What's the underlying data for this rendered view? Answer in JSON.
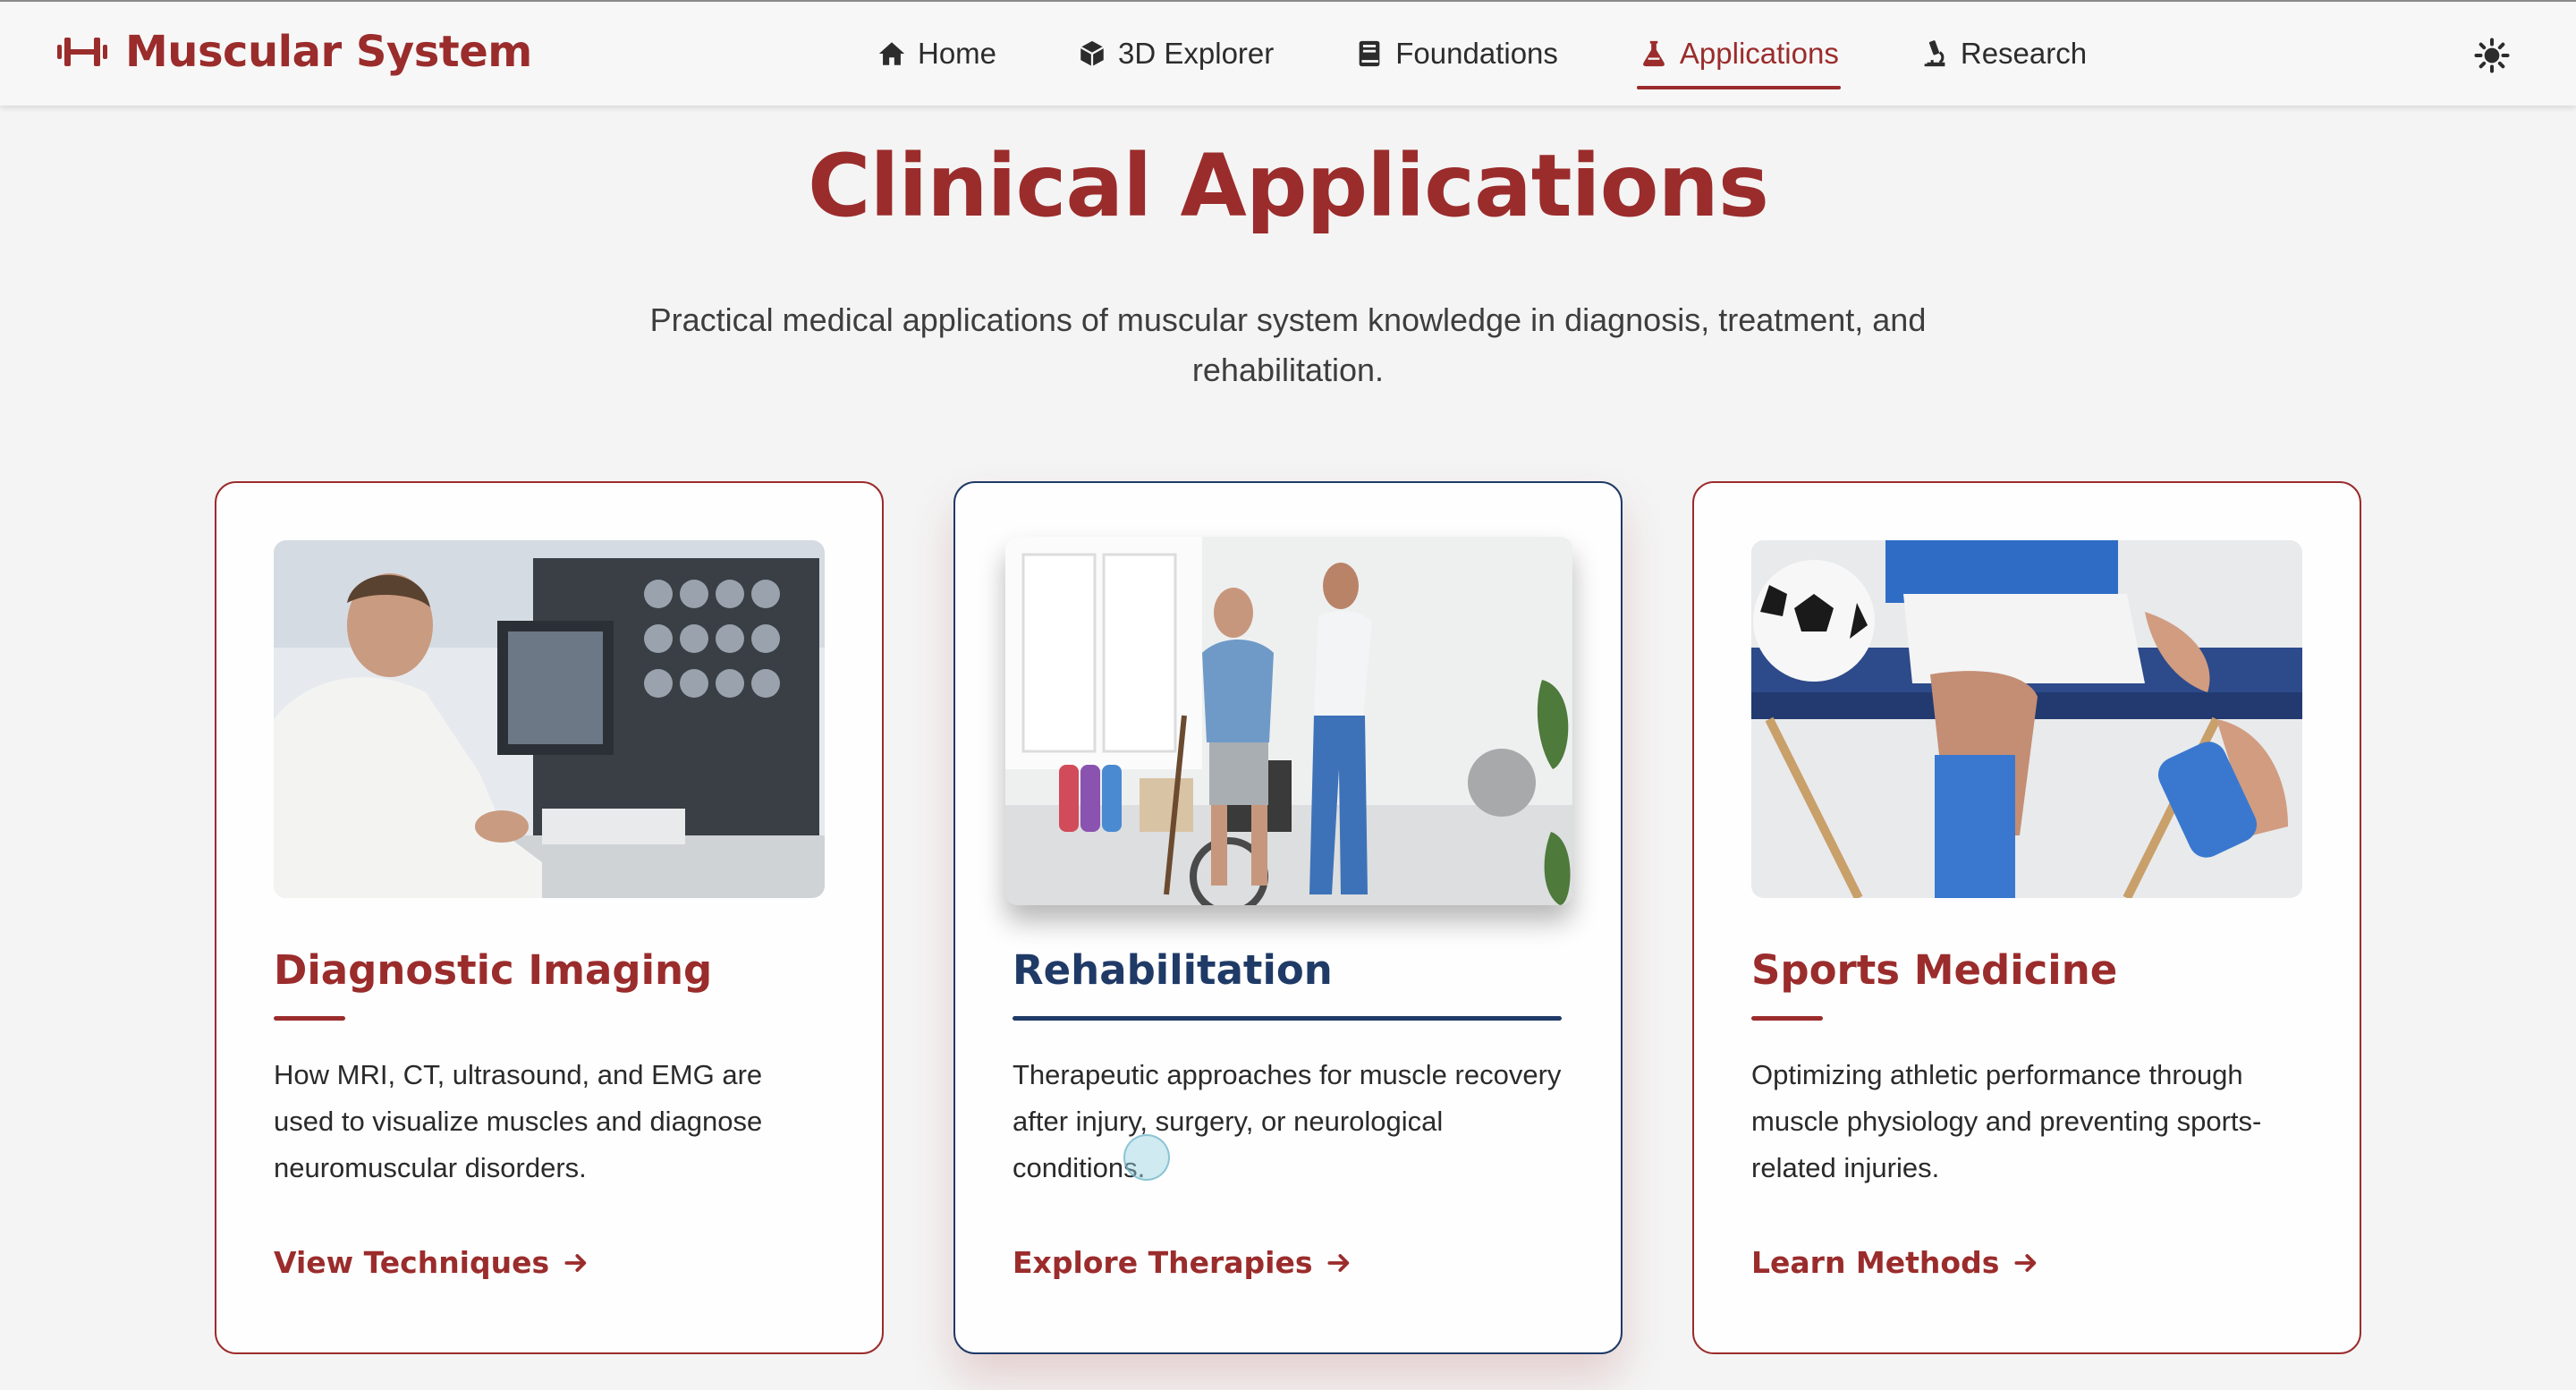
{
  "brand": {
    "name": "Muscular System",
    "icon": "dumbbell-icon"
  },
  "nav": {
    "items": [
      {
        "label": "Home",
        "icon": "home-icon"
      },
      {
        "label": "3D Explorer",
        "icon": "cube-icon"
      },
      {
        "label": "Foundations",
        "icon": "book-icon"
      },
      {
        "label": "Applications",
        "icon": "flask-icon",
        "active": true
      },
      {
        "label": "Research",
        "icon": "microscope-icon"
      }
    ],
    "theme_toggle_icon": "sun-icon"
  },
  "hero": {
    "title": "Clinical Applications",
    "subtitle": "Practical medical applications of muscular system knowledge in diagnosis, treatment, and rehabilitation."
  },
  "cards": [
    {
      "title": "Diagnostic Imaging",
      "description": "How MRI, CT, ultrasound, and EMG are used to visualize muscles and diagnose neuromuscular disorders.",
      "link": "View Techniques",
      "image": "doctor-reviewing-scans-photo"
    },
    {
      "title": "Rehabilitation",
      "description": "Therapeutic approaches for muscle recovery after injury, surgery, or neurological conditions.",
      "link": "Explore Therapies",
      "image": "physiotherapist-assisting-patient-photo"
    },
    {
      "title": "Sports Medicine",
      "description": "Optimizing athletic performance through muscle physiology and preventing sports-related injuries.",
      "link": "Learn Methods",
      "image": "athlete-knee-taping-photo"
    }
  ],
  "colors": {
    "accent": "#9b2c2c",
    "secondary": "#1f3a66",
    "background": "#f4f4f4"
  }
}
